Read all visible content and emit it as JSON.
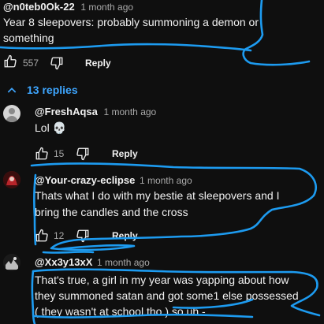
{
  "accent_color": "#3ea6ff",
  "annotation_color": "#1d9bf0",
  "comments": [
    {
      "handle": "@n0teb0Ok-22",
      "time": "1 month ago",
      "text_lines": [
        "Year 8 sleepovers: probably summoning a demon or",
        "something"
      ],
      "likes": "557",
      "reply_label": "Reply"
    },
    {
      "handle": "@FreshAqsa",
      "time": "1 month ago",
      "text": "Lol 💀",
      "likes": "15",
      "reply_label": "Reply",
      "avatar_icon": "default-avatar-icon"
    },
    {
      "handle": "@Your-crazy-eclipse",
      "time": "1 month ago",
      "text_lines": [
        "Thats what I do with my bestie at sleepovers and I",
        "bring the candles and the cross"
      ],
      "likes": "12",
      "reply_label": "Reply",
      "avatar_icon": "red-anime-avatar-icon"
    },
    {
      "handle": "@Xx3y13xX",
      "time": "1 month ago",
      "text_lines": [
        "That's true, a girl in my year was yapping about how",
        "they summoned satan and got some1 else possessed",
        "( they wasn't at school tho ) so uh -"
      ],
      "avatar_icon": "black-white-avatar-icon"
    }
  ],
  "replies_toggle": {
    "label": "13 replies",
    "icon": "chevron-up-icon"
  }
}
